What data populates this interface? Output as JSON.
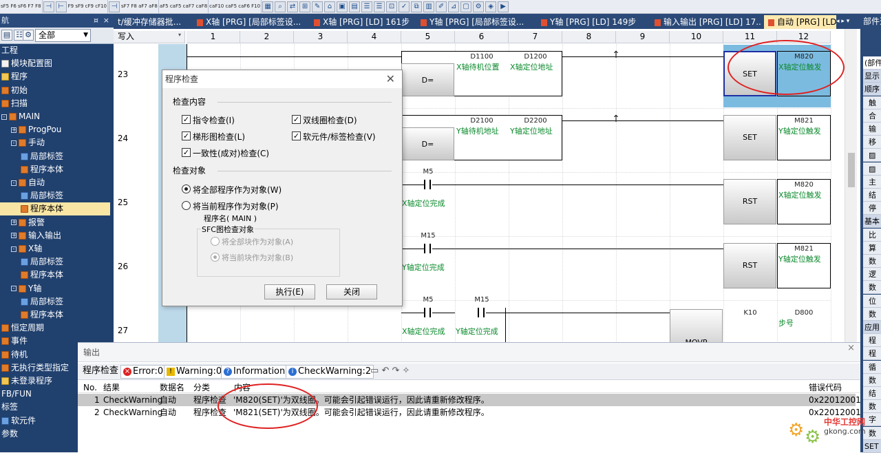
{
  "fkeys_row": [
    "sF5 F6 sF6 F7 F8",
    "F9 sF9 cF9 cF10",
    "sF7 F8 aF7 aF8",
    "aF5 caF5 caF7 caF8",
    "caF10 caF5 caF6 F10"
  ],
  "left_panel": {
    "pin": "¤",
    "close": "×",
    "combo_value": "全部",
    "tree": [
      {
        "label": "工程",
        "level": 0,
        "icon": "none",
        "expand": ""
      },
      {
        "label": "模块配置图",
        "level": 0,
        "icon": "doc",
        "expand": ""
      },
      {
        "label": "程序",
        "level": 0,
        "icon": "fold",
        "expand": ""
      },
      {
        "label": "初始",
        "level": 0,
        "icon": "prg",
        "expand": ""
      },
      {
        "label": "扫描",
        "level": 0,
        "icon": "prg",
        "expand": ""
      },
      {
        "label": "MAIN",
        "level": 0,
        "icon": "prg",
        "expand": "-"
      },
      {
        "label": "ProgPou",
        "level": 1,
        "icon": "prg",
        "expand": "+"
      },
      {
        "label": "手动",
        "level": 1,
        "icon": "prg",
        "expand": "-"
      },
      {
        "label": "局部标签",
        "level": 2,
        "icon": "lbl",
        "expand": ""
      },
      {
        "label": "程序本体",
        "level": 2,
        "icon": "prg",
        "expand": ""
      },
      {
        "label": "自动",
        "level": 1,
        "icon": "prg",
        "expand": "-"
      },
      {
        "label": "局部标签",
        "level": 2,
        "icon": "lbl",
        "expand": ""
      },
      {
        "label": "程序本体",
        "level": 2,
        "icon": "prg",
        "expand": "",
        "selected": true
      },
      {
        "label": "报警",
        "level": 1,
        "icon": "prg",
        "expand": "+"
      },
      {
        "label": "输入输出",
        "level": 1,
        "icon": "prg",
        "expand": "+"
      },
      {
        "label": "X轴",
        "level": 1,
        "icon": "prg",
        "expand": "-"
      },
      {
        "label": "局部标签",
        "level": 2,
        "icon": "lbl",
        "expand": ""
      },
      {
        "label": "程序本体",
        "level": 2,
        "icon": "prg",
        "expand": ""
      },
      {
        "label": "Y轴",
        "level": 1,
        "icon": "prg",
        "expand": "-"
      },
      {
        "label": "局部标签",
        "level": 2,
        "icon": "lbl",
        "expand": ""
      },
      {
        "label": "程序本体",
        "level": 2,
        "icon": "prg",
        "expand": ""
      },
      {
        "label": "恒定周期",
        "level": 0,
        "icon": "prg",
        "expand": ""
      },
      {
        "label": "事件",
        "level": 0,
        "icon": "prg",
        "expand": ""
      },
      {
        "label": "待机",
        "level": 0,
        "icon": "prg",
        "expand": ""
      },
      {
        "label": "无执行类型指定",
        "level": 0,
        "icon": "prg",
        "expand": ""
      },
      {
        "label": "未登录程序",
        "level": 0,
        "icon": "fold",
        "expand": ""
      },
      {
        "label": "FB/FUN",
        "level": 0,
        "icon": "none",
        "expand": ""
      },
      {
        "label": "标签",
        "level": 0,
        "icon": "none",
        "expand": ""
      },
      {
        "label": "软元件",
        "level": 0,
        "icon": "lbl",
        "expand": ""
      },
      {
        "label": "参数",
        "level": 0,
        "icon": "none",
        "expand": ""
      }
    ]
  },
  "tabs": [
    {
      "label": "t/缓冲存储器批..."
    },
    {
      "label": "X轴 [PRG] [局部标签设..."
    },
    {
      "label": "X轴 [PRG] [LD] 161步"
    },
    {
      "label": "Y轴 [PRG] [局部标签设..."
    },
    {
      "label": "Y轴 [PRG] [LD] 149步"
    },
    {
      "label": "输入输出 [PRG] [LD] 17..."
    },
    {
      "label": "自动 [PRG] [LD]",
      "active": true
    }
  ],
  "tab_arrows": "◂ ▸ ▾",
  "right_panel": {
    "title": "部件选择",
    "items": [
      "(部件",
      "显示",
      "顺序",
      "触",
      "合",
      "输",
      "移",
      "▨",
      "▨",
      "主",
      "结",
      "停",
      "基本",
      "比",
      "算",
      "数",
      "逻",
      "数",
      "位",
      "数",
      "应用",
      "程",
      "程",
      "循",
      "数",
      "结",
      "数",
      "字",
      "数",
      "SET"
    ]
  },
  "ladder": {
    "write_mode": "写入",
    "columns": [
      "1",
      "2",
      "3",
      "4",
      "5",
      "6",
      "7",
      "8",
      "9",
      "10",
      "11",
      "12"
    ],
    "rows": [
      {
        "num": "23",
        "op": "D=",
        "s1": "D1100",
        "s1c": "X轴待机位置",
        "s2": "D1200",
        "s2c": "X轴定位地址",
        "coil": "SET",
        "dev": "M820",
        "devc": "X轴定位触发"
      },
      {
        "num": "24",
        "op": "D=",
        "s1": "D2100",
        "s1c": "Y轴待机地址",
        "s2": "D2200",
        "s2c": "Y轴定位地址",
        "coil": "SET",
        "dev": "M821",
        "devc": "Y轴定位触发"
      },
      {
        "num": "25",
        "contact": "M5",
        "contactc": "X轴定位完成",
        "coil": "RST",
        "dev": "M820",
        "devc": "X轴定位触发"
      },
      {
        "num": "26",
        "contact": "M15",
        "contactc": "Y轴定位完成",
        "coil": "RST",
        "dev": "M821",
        "devc": "Y轴定位触发"
      },
      {
        "num": "27",
        "contact": "M5",
        "contactc": "X轴定位完成",
        "contact2": "M15",
        "contact2c": "Y轴定位完成",
        "coil": "MOVP",
        "dev1": "K10",
        "dev": "D800",
        "devc": "步号"
      }
    ]
  },
  "dialog": {
    "title": "程序检查",
    "close": "✕",
    "section1": "检查内容",
    "checks": [
      {
        "label": "指令检查(I)",
        "checked": true
      },
      {
        "label": "双线圈检查(D)",
        "checked": true
      },
      {
        "label": "梯形图检查(L)",
        "checked": true
      },
      {
        "label": "软元件/标签检查(V)",
        "checked": true
      },
      {
        "label": "一致性(成对)检查(C)",
        "checked": true
      }
    ],
    "section2": "检查对象",
    "radios": [
      {
        "label": "将全部程序作为对象(W)",
        "on": true
      },
      {
        "label": "将当前程序作为对象(P)",
        "on": false
      }
    ],
    "prog_name": "程序名( MAIN )",
    "sfc_group": "SFC图检查对象",
    "sfc_radios": [
      {
        "label": "将全部块作为对象(A)",
        "on": false
      },
      {
        "label": "将当前块作为对象(B)",
        "on": true
      }
    ],
    "exec_btn": "执行(E)",
    "close_btn": "关闭"
  },
  "output": {
    "title": "输出",
    "close": "×",
    "toolbar": {
      "check": "程序检查",
      "error": "Error:0",
      "warning": "Warning:0",
      "info": "Information",
      "checkwarning": "CheckWarning:2"
    },
    "headers": [
      "No.",
      "结果",
      "数据名",
      "分类",
      "内容",
      "错误代码"
    ],
    "rows": [
      {
        "no": "1",
        "result": "CheckWarning",
        "data": "自动",
        "cat": "程序检查",
        "content": "'M820(SET)'为双线圈。可能会引起错误运行，因此请重新修改程序。",
        "code": "0x22012001"
      },
      {
        "no": "2",
        "result": "CheckWarning",
        "data": "自动",
        "cat": "程序检查",
        "content": "'M821(SET)'为双线圈。可能会引起错误运行，因此请重新修改程序。",
        "code": "0x22012001"
      }
    ]
  },
  "watermark": {
    "t1": "中华工控网",
    "t2": "gkong.com"
  },
  "colors": {
    "nav": "#20406e",
    "tab_active": "#fce9b0",
    "selected_coil": "#7cbbe0",
    "comment": "#0b8a2c",
    "annotation": "#e02020"
  }
}
